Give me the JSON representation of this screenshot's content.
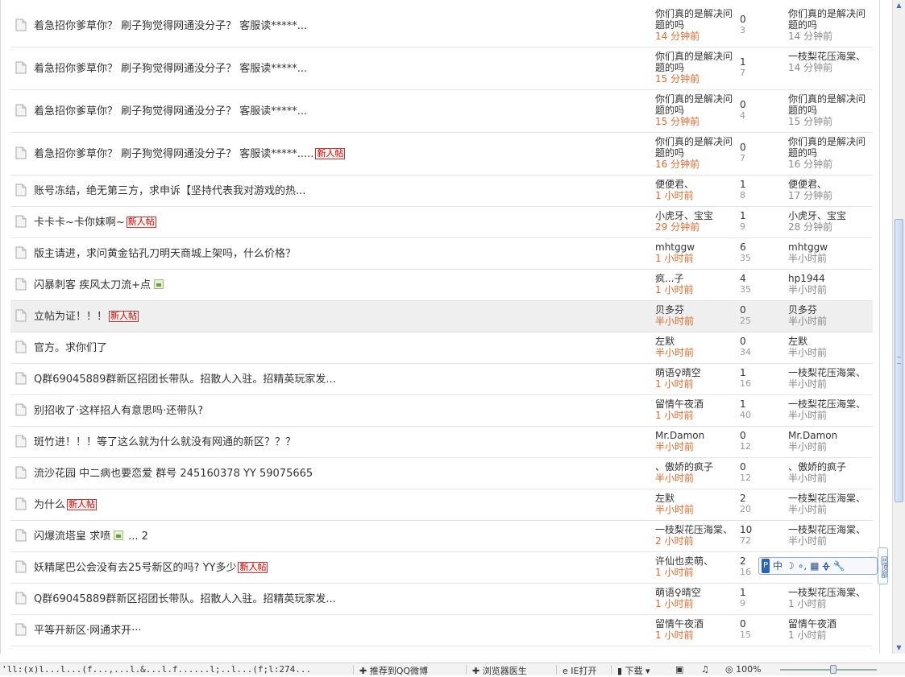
{
  "threads": [
    {
      "title": "着急招你爹草你？ 刷子狗觉得网通没分子？ 客服读*****...",
      "new": "",
      "pager": "",
      "author": "你们真的是解决问题的吗",
      "author_time": "14 分钟前",
      "replies": "0",
      "views": "3",
      "last_author": "你们真的是解决问题的吗",
      "last_time": "14 分钟前"
    },
    {
      "title": "着急招你爹草你？ 刷子狗觉得网通没分子？ 客服读*****...",
      "new": "",
      "pager": "",
      "author": "你们真的是解决问题的吗",
      "author_time": "15 分钟前",
      "replies": "1",
      "views": "7",
      "last_author": "一枝梨花压海棠、",
      "last_time": "14 分钟前"
    },
    {
      "title": "着急招你爹草你？ 刷子狗觉得网通没分子？ 客服读*****...",
      "new": "",
      "pager": "",
      "author": "你们真的是解决问题的吗",
      "author_time": "15 分钟前",
      "replies": "0",
      "views": "4",
      "last_author": "你们真的是解决问题的吗",
      "last_time": "15 分钟前"
    },
    {
      "title": "着急招你爹草你？ 刷子狗觉得网通没分子？ 客服读*****.....",
      "new": "新人帖",
      "pager": "",
      "author": "你们真的是解决问题的吗",
      "author_time": "16 分钟前",
      "replies": "0",
      "views": "7",
      "last_author": "你们真的是解决问题的吗",
      "last_time": "16 分钟前"
    },
    {
      "title": "账号冻结，绝无第三方，求申诉【坚持代表我对游戏的热...",
      "new": "",
      "pager": "",
      "author": "便便君、",
      "author_time": "1 小时前",
      "replies": "1",
      "views": "8",
      "last_author": "便便君、",
      "last_time": "17 分钟前"
    },
    {
      "title": "卡卡卡~卡你妹啊~",
      "new": "新人帖",
      "pager": "",
      "author": "小虎牙、宝宝",
      "author_time": "29 分钟前",
      "replies": "1",
      "views": "9",
      "last_author": "小虎牙、宝宝",
      "last_time": "28 分钟前"
    },
    {
      "title": "版主请进，求问黄金钻孔刀明天商城上架吗，什么价格？",
      "new": "",
      "pager": "",
      "author": "mhtggw",
      "author_time": "1 小时前",
      "replies": "6",
      "views": "35",
      "last_author": "mhtggw",
      "last_time": "半小时前"
    },
    {
      "title": "闪暴刺客 疾风太刀流+点",
      "new": "",
      "image": "image-attachment",
      "pager": "",
      "author": "疯...子",
      "author_time": "1 小时前",
      "replies": "4",
      "views": "35",
      "last_author": "hp1944",
      "last_time": "半小时前"
    },
    {
      "title": "立帖为证！！！",
      "new": "新人帖",
      "pager": "",
      "author": "贝多芬",
      "author_time": "半小时前",
      "replies": "0",
      "views": "25",
      "last_author": "贝多芬",
      "last_time": "半小时前"
    },
    {
      "title": "官方。求你们了",
      "new": "",
      "pager": "",
      "author": "左默",
      "author_time": "半小时前",
      "replies": "0",
      "views": "34",
      "last_author": "左默",
      "last_time": "半小时前"
    },
    {
      "title": "Q群69045889群新区招团长带队。招散人入驻。招精英玩家发...",
      "new": "",
      "pager": "",
      "author": "萌语♀晴空",
      "author_time": "1 小时前",
      "replies": "1",
      "views": "16",
      "last_author": "一枝梨花压海棠、",
      "last_time": "半小时前"
    },
    {
      "title": "别招收了·这样招人有意思吗·还带队?",
      "new": "",
      "pager": "",
      "author": "留情午夜酒",
      "author_time": "1 小时前",
      "replies": "1",
      "views": "40",
      "last_author": "一枝梨花压海棠、",
      "last_time": "半小时前"
    },
    {
      "title": "斑竹进！！！等了这么就为什么就没有网通的新区？？？",
      "new": "",
      "pager": "",
      "author": "Mr.Damon",
      "author_time": "半小时前",
      "replies": "0",
      "views": "12",
      "last_author": "Mr.Damon",
      "last_time": "半小时前"
    },
    {
      "title": "流沙花园 中二病也要恋爱 群号 245160378 YY 59075665",
      "new": "",
      "pager": "",
      "author": "、傲娇的疯子",
      "author_time": "半小时前",
      "replies": "0",
      "views": "12",
      "last_author": "、傲娇的疯子",
      "last_time": "半小时前"
    },
    {
      "title": "为什么",
      "new": "新人帖",
      "pager": "",
      "author": "左默",
      "author_time": "半小时前",
      "replies": "2",
      "views": "20",
      "last_author": "一枝梨花压海棠、",
      "last_time": "半小时前"
    },
    {
      "title": "闪爆流塔皇 求喷",
      "new": "",
      "image": "image-attachment",
      "pager": "... 2",
      "author": "一枝梨花压海棠、",
      "author_time": "2 小时前",
      "replies": "10",
      "views": "72",
      "last_author": "一枝梨花压海棠、",
      "last_time": "半小时前"
    },
    {
      "title": "妖精尾巴公会没有去25号新区的吗? YY多少",
      "new": "新人帖",
      "pager": "",
      "author": "许仙也卖萌、",
      "author_time": "1 小时前",
      "replies": "2",
      "views": "16",
      "last_author": "",
      "last_time": ""
    },
    {
      "title": "Q群69045889群新区招团长带队。招散人入驻。招精英玩家发...",
      "new": "",
      "pager": "",
      "author": "萌语♀晴空",
      "author_time": "1 小时前",
      "replies": "1",
      "views": "9",
      "last_author": "一枝梨花压海棠、",
      "last_time": "1 小时前"
    },
    {
      "title": "平等开新区·网通求开···",
      "new": "",
      "pager": "",
      "author": "留情午夜酒",
      "author_time": "1 小时前",
      "replies": "0",
      "views": "15",
      "last_author": "留情午夜酒",
      "last_time": "1 小时前"
    }
  ],
  "ime": {
    "logo": "P",
    "mode": "中",
    "items": [
      "☽",
      "∘,",
      "▦",
      "ᚖ",
      "🔧"
    ]
  },
  "side_tab": "回顶部",
  "statusbar": {
    "url": "'ll:(x)l...l...(f...,...l.&...l.f......l;..l...(f;l:274...",
    "items": [
      "推荐到QQ微博",
      "浏览器医生",
      "IE打开",
      "下载",
      "100%"
    ]
  },
  "colors": {
    "time_recent": "#e06a2a",
    "new_tag": "#cc0000",
    "row_highlight": "#efefef"
  }
}
